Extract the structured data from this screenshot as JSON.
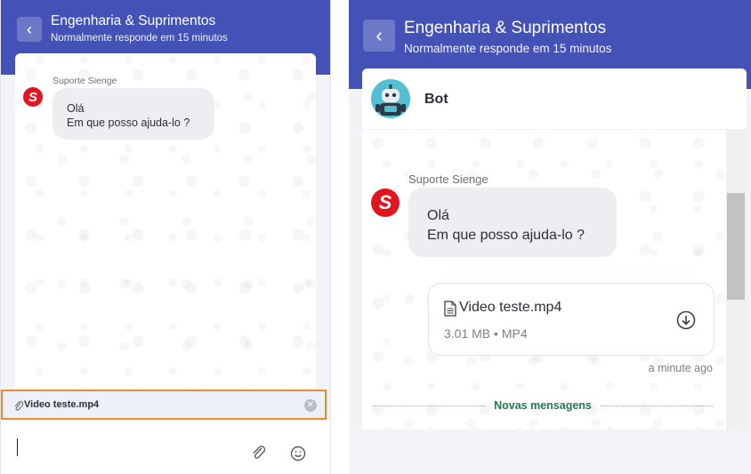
{
  "left": {
    "header": {
      "title": "Engenharia & Suprimentos",
      "subtitle": "Normalmente responde em 15 minutos",
      "back_icon": "chevron-left-icon"
    },
    "message": {
      "sender": "Suporte Sienge",
      "avatar_letter": "S",
      "line1": "Olá",
      "line2": "Em que posso ajuda-lo ?"
    },
    "attachment": {
      "filename": "Video teste.mp4",
      "remove_icon": "close-circle-icon"
    },
    "composer": {
      "attach_icon": "paperclip-icon",
      "emoji_icon": "smiley-icon"
    }
  },
  "right": {
    "header": {
      "title": "Engenharia & Suprimentos",
      "subtitle": "Normalmente responde em 15 minutos",
      "back_icon": "chevron-left-icon"
    },
    "bot": {
      "name": "Bot"
    },
    "message": {
      "sender": "Suporte Sienge",
      "avatar_letter": "S",
      "line1": "Olá",
      "line2": "Em que posso ajuda-lo ?"
    },
    "file": {
      "name": "Video teste.mp4",
      "meta": "3.01 MB • MP4",
      "icon": "document-icon",
      "download_icon": "download-circle-icon"
    },
    "timestamp": "a minute ago",
    "divider_label": "Novas mensagens"
  },
  "colors": {
    "header_bg": "#4452b8",
    "brand_red": "#e2151f",
    "highlight_border": "#f28b30",
    "divider_text": "#1f7a52"
  }
}
